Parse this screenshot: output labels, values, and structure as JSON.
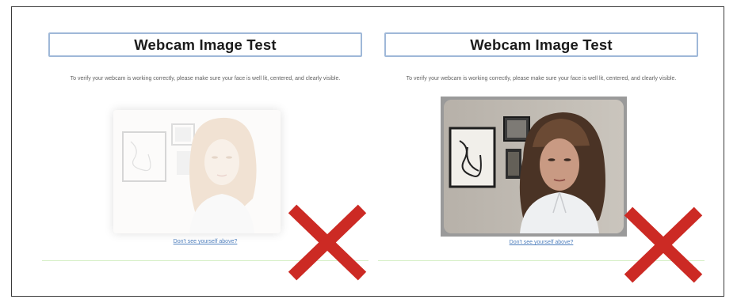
{
  "panels": [
    {
      "title": "Webcam Image Test",
      "instructions": "To verify your webcam is working correctly, please make sure your face is well lit, centered, and clearly visible.",
      "link": "Don't see yourself above?",
      "state": "overexposed"
    },
    {
      "title": "Webcam Image Test",
      "instructions": "To verify your webcam is working correctly, please make sure your face is well lit, centered, and clearly visible.",
      "link": "Don't see yourself above?",
      "state": "correct exposure"
    }
  ],
  "colors": {
    "title_border": "#9fb8d8",
    "link": "#4f7fbd",
    "separator": "#d6efc6",
    "x_mark": "#cc2a24"
  },
  "icons": [
    "x-mark-icon"
  ]
}
